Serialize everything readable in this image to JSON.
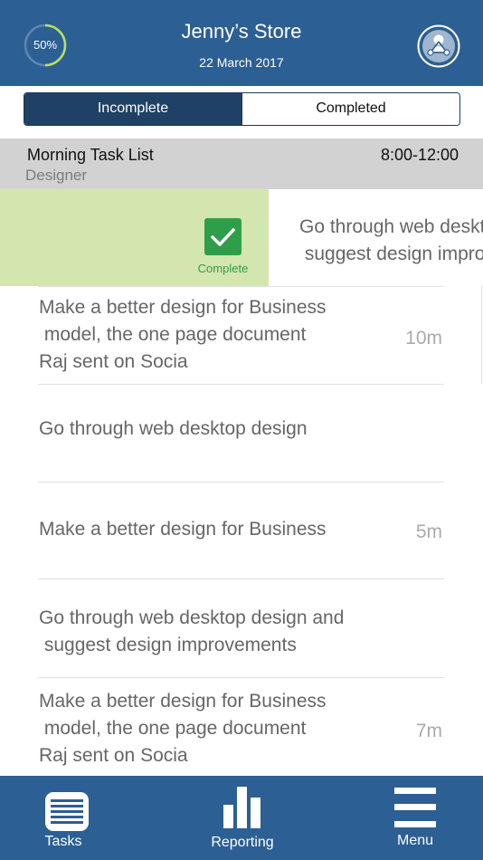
{
  "header": {
    "progress_label": "50%",
    "progress_value": 0.5,
    "store_name": "Jenny’s Store",
    "date": "22 March 2017",
    "team_icon": "team-network-icon"
  },
  "tabs_filter": {
    "incomplete_label": "Incomplete",
    "completed_label": "Completed",
    "selected": "Incomplete"
  },
  "section": {
    "title": "Morning Task List",
    "role": "Designer",
    "time": "8:00-12:00"
  },
  "swiped_task": {
    "action_label": "Complete",
    "text": "Go through web desktop design and\n suggest design improvements"
  },
  "tasks": [
    {
      "text": "Make a better design for Business\n model, the one page document\nRaj sent on Socia",
      "duration": "10m"
    },
    {
      "text": "Go through web desktop design",
      "duration": ""
    },
    {
      "text": "Make a better design for Business",
      "duration": "5m"
    },
    {
      "text": "Go through web desktop design and\n suggest design improvements",
      "duration": ""
    },
    {
      "text": "Make a better design for Business\n model, the one page document\nRaj sent on Socia",
      "duration": "7m"
    }
  ],
  "tabbar": {
    "tasks_label": "Tasks",
    "reporting_label": "Reporting",
    "menu_label": "Menu"
  },
  "colors": {
    "primary": "#2c5f93",
    "segment_active": "#1f4166",
    "complete_green": "#2f9e4a",
    "swipe_bg": "#d3e6b0",
    "section_bg": "#d2d2d2"
  }
}
